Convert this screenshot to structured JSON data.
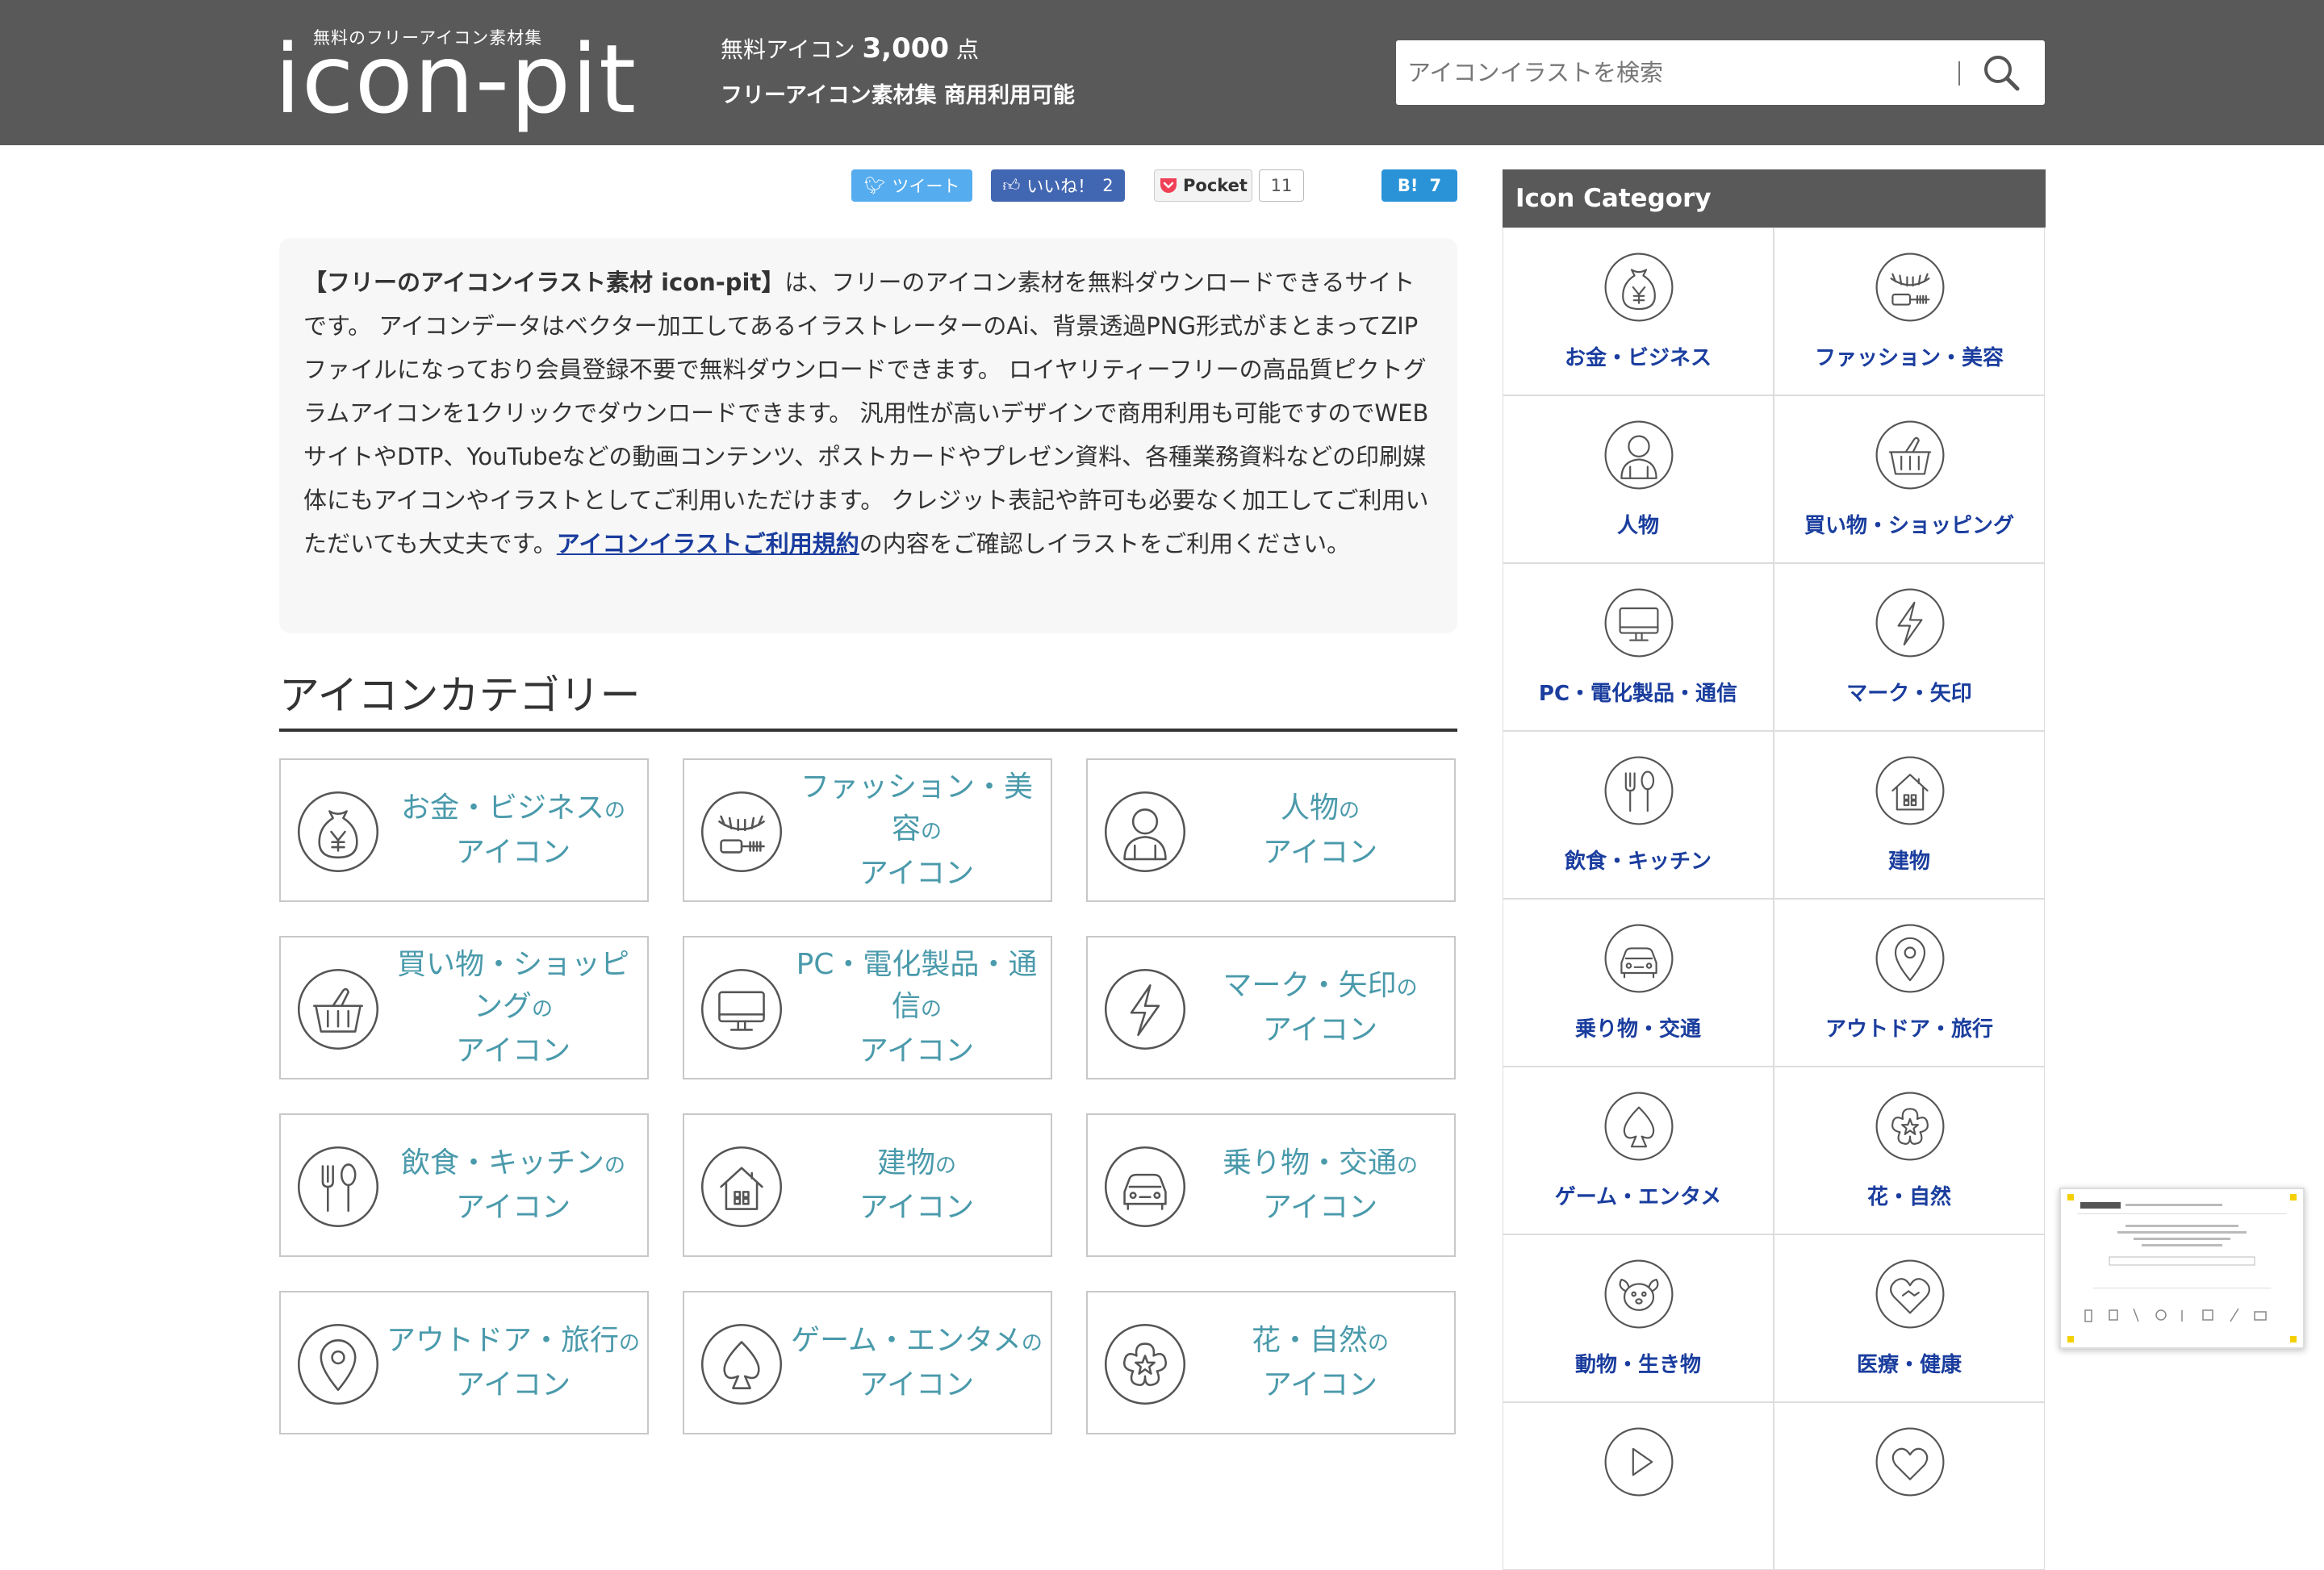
{
  "header": {
    "logo_sub": "無料のフリーアイコン素材集",
    "logo": "icon-pit",
    "tagline1_prefix": "無料アイコン",
    "tagline1_count": "3,000",
    "tagline1_suffix": "点",
    "tagline2": "フリーアイコン素材集 商用利用可能",
    "search_placeholder": "アイコンイラストを検索"
  },
  "share": {
    "tweet": "ツイート",
    "like": "いいね！",
    "like_count": "2",
    "pocket": "Pocket",
    "pocket_count": "11",
    "hatena": "B!",
    "hatena_count": "7"
  },
  "intro": {
    "bold": "【フリーのアイコンイラスト素材 icon-pit】",
    "text1": "は、フリーのアイコン素材を無料ダウンロードできるサイトです。 アイコンデータはベクター加工してあるイラストレーターのAi、背景透過PNG形式がまとまってZIPファイルになっており会員登録不要で無料ダウンロードできます。 ロイヤリティーフリーの高品質ピクトグラムアイコンを1クリックでダウンロードできます。 汎用性が高いデザインで商用利用も可能ですのでWEBサイトやDTP、YouTubeなどの動画コンテンツ、ポストカードやプレゼン資料、各種業務資料などの印刷媒体にもアイコンやイラストとしてご利用いただけます。 クレジット表記や許可も必要なく加工してご利用いただいても大丈夫です。",
    "link": "アイコンイラストご利用規約",
    "text2": "の内容をご確認しイラストをご利用ください。"
  },
  "section_title": "アイコンカテゴリー",
  "categories": [
    {
      "line1": "お金・ビジネス",
      "small": "の",
      "line2": "アイコン",
      "icon": "money-bag-icon"
    },
    {
      "line1": "ファッション・美容",
      "small": "の",
      "line2": "アイコン",
      "icon": "eyelash-icon"
    },
    {
      "line1": "人物",
      "small": "の",
      "line2": "アイコン",
      "icon": "person-icon"
    },
    {
      "line1": "買い物・ショッピング",
      "small": "の",
      "line2": "アイコン",
      "icon": "basket-icon"
    },
    {
      "line1": "PC・電化製品・通信",
      "small": "の",
      "line2": "アイコン",
      "icon": "monitor-icon"
    },
    {
      "line1": "マーク・矢印",
      "small": "の",
      "line2": "アイコン",
      "icon": "lightning-icon"
    },
    {
      "line1": "飲食・キッチン",
      "small": "の",
      "line2": "アイコン",
      "icon": "fork-spoon-icon"
    },
    {
      "line1": "建物",
      "small": "の",
      "line2": "アイコン",
      "icon": "house-icon"
    },
    {
      "line1": "乗り物・交通",
      "small": "の",
      "line2": "アイコン",
      "icon": "car-icon"
    },
    {
      "line1": "アウトドア・旅行",
      "small": "の",
      "line2": "アイコン",
      "icon": "map-pin-icon"
    },
    {
      "line1": "ゲーム・エンタメ",
      "small": "の",
      "line2": "アイコン",
      "icon": "spade-icon"
    },
    {
      "line1": "花・自然",
      "small": "の",
      "line2": "アイコン",
      "icon": "flower-icon"
    }
  ],
  "sidebar": {
    "title": "Icon Category",
    "items": [
      {
        "label": "お金・ビジネス",
        "icon": "money-bag-icon"
      },
      {
        "label": "ファッション・美容",
        "icon": "eyelash-icon"
      },
      {
        "label": "人物",
        "icon": "person-icon"
      },
      {
        "label": "買い物・ショッピング",
        "icon": "basket-icon"
      },
      {
        "label": "PC・電化製品・通信",
        "icon": "monitor-icon"
      },
      {
        "label": "マーク・矢印",
        "icon": "lightning-icon"
      },
      {
        "label": "飲食・キッチン",
        "icon": "fork-spoon-icon"
      },
      {
        "label": "建物",
        "icon": "house-icon"
      },
      {
        "label": "乗り物・交通",
        "icon": "car-icon"
      },
      {
        "label": "アウトドア・旅行",
        "icon": "map-pin-icon"
      },
      {
        "label": "ゲーム・エンタメ",
        "icon": "spade-icon"
      },
      {
        "label": "花・自然",
        "icon": "flower-icon"
      },
      {
        "label": "動物・生き物",
        "icon": "dog-icon"
      },
      {
        "label": "医療・健康",
        "icon": "heart-hand-icon"
      },
      {
        "label": "",
        "icon": "play-icon"
      },
      {
        "label": "",
        "icon": "heart-icon"
      }
    ]
  },
  "thumb": {
    "site": "ilrustock"
  },
  "colors": {
    "header_bg": "#595959",
    "card_text": "#4a9aab",
    "sidebar_label": "#1a3d9e",
    "icon_stroke": "#555555"
  }
}
